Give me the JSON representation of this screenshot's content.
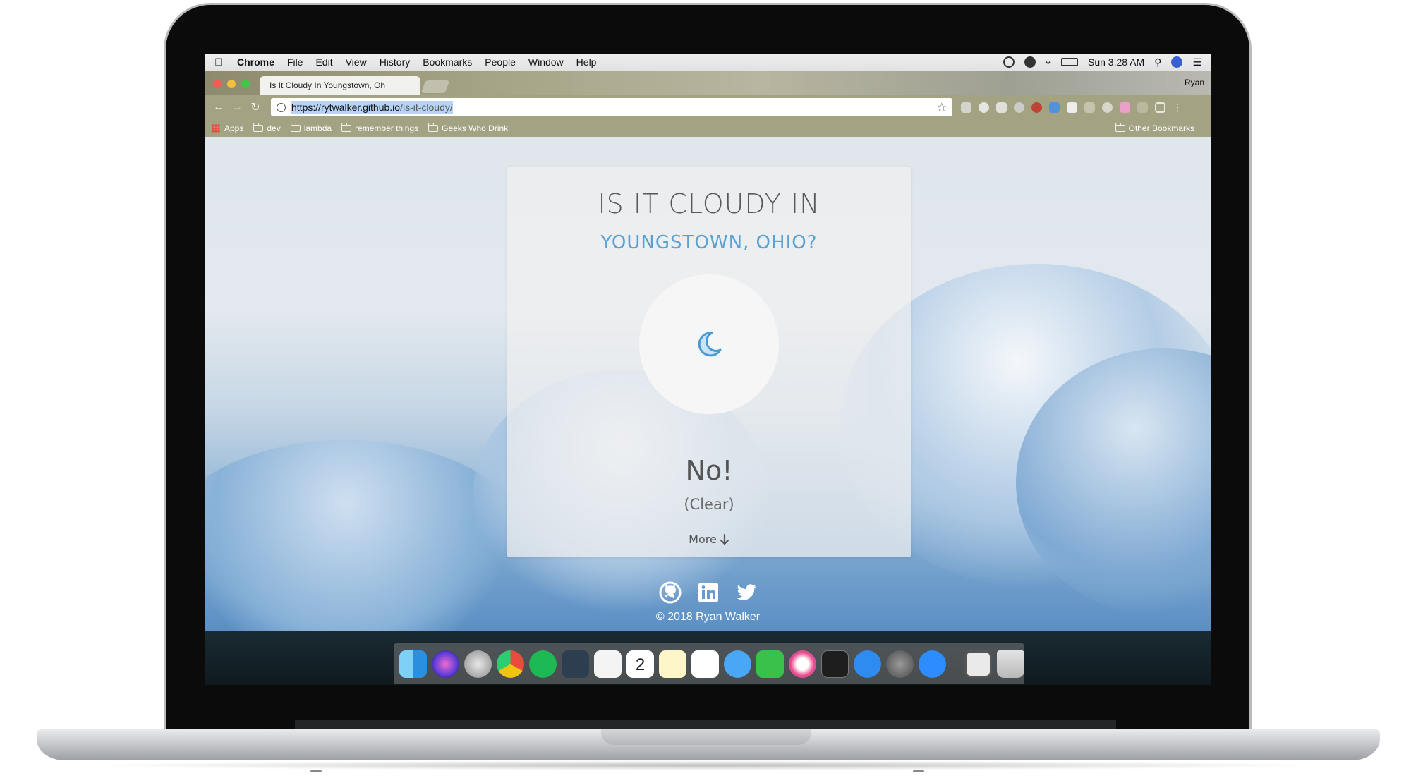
{
  "menubar": {
    "app_name": "Chrome",
    "items": [
      "File",
      "Edit",
      "View",
      "History",
      "Bookmarks",
      "People",
      "Window",
      "Help"
    ],
    "clock": "Sun 3:28 AM"
  },
  "browser": {
    "tab_title": "Is It Cloudy In Youngstown, Oh",
    "profile_name": "Ryan",
    "url_host": "https://rytwalker.github.io",
    "url_path": "/is-it-cloudy/",
    "bookmarks": [
      "Apps",
      "dev",
      "lambda",
      "remember things",
      "Geeks Who Drink"
    ],
    "other_bookmarks": "Other Bookmarks"
  },
  "page": {
    "title": "IS IT CLOUDY IN",
    "location": "YOUNGSTOWN, OHIO?",
    "weather_icon": "moon-icon",
    "answer": "No!",
    "condition": "(Clear)",
    "more_label": "More",
    "footer": "© 2018 Ryan Walker",
    "social": [
      "github-icon",
      "linkedin-icon",
      "twitter-icon"
    ],
    "accent_color": "#5aa2d2"
  },
  "dock": {
    "apps": [
      "finder",
      "siri",
      "launchpad",
      "chrome",
      "spotify",
      "vscode",
      "sublime-text",
      "calendar",
      "notes",
      "reminders",
      "messages",
      "facetime",
      "itunes",
      "terminal",
      "app-store",
      "system-preferences",
      "zoom",
      "preview",
      "trash"
    ],
    "calendar_day": "2"
  }
}
